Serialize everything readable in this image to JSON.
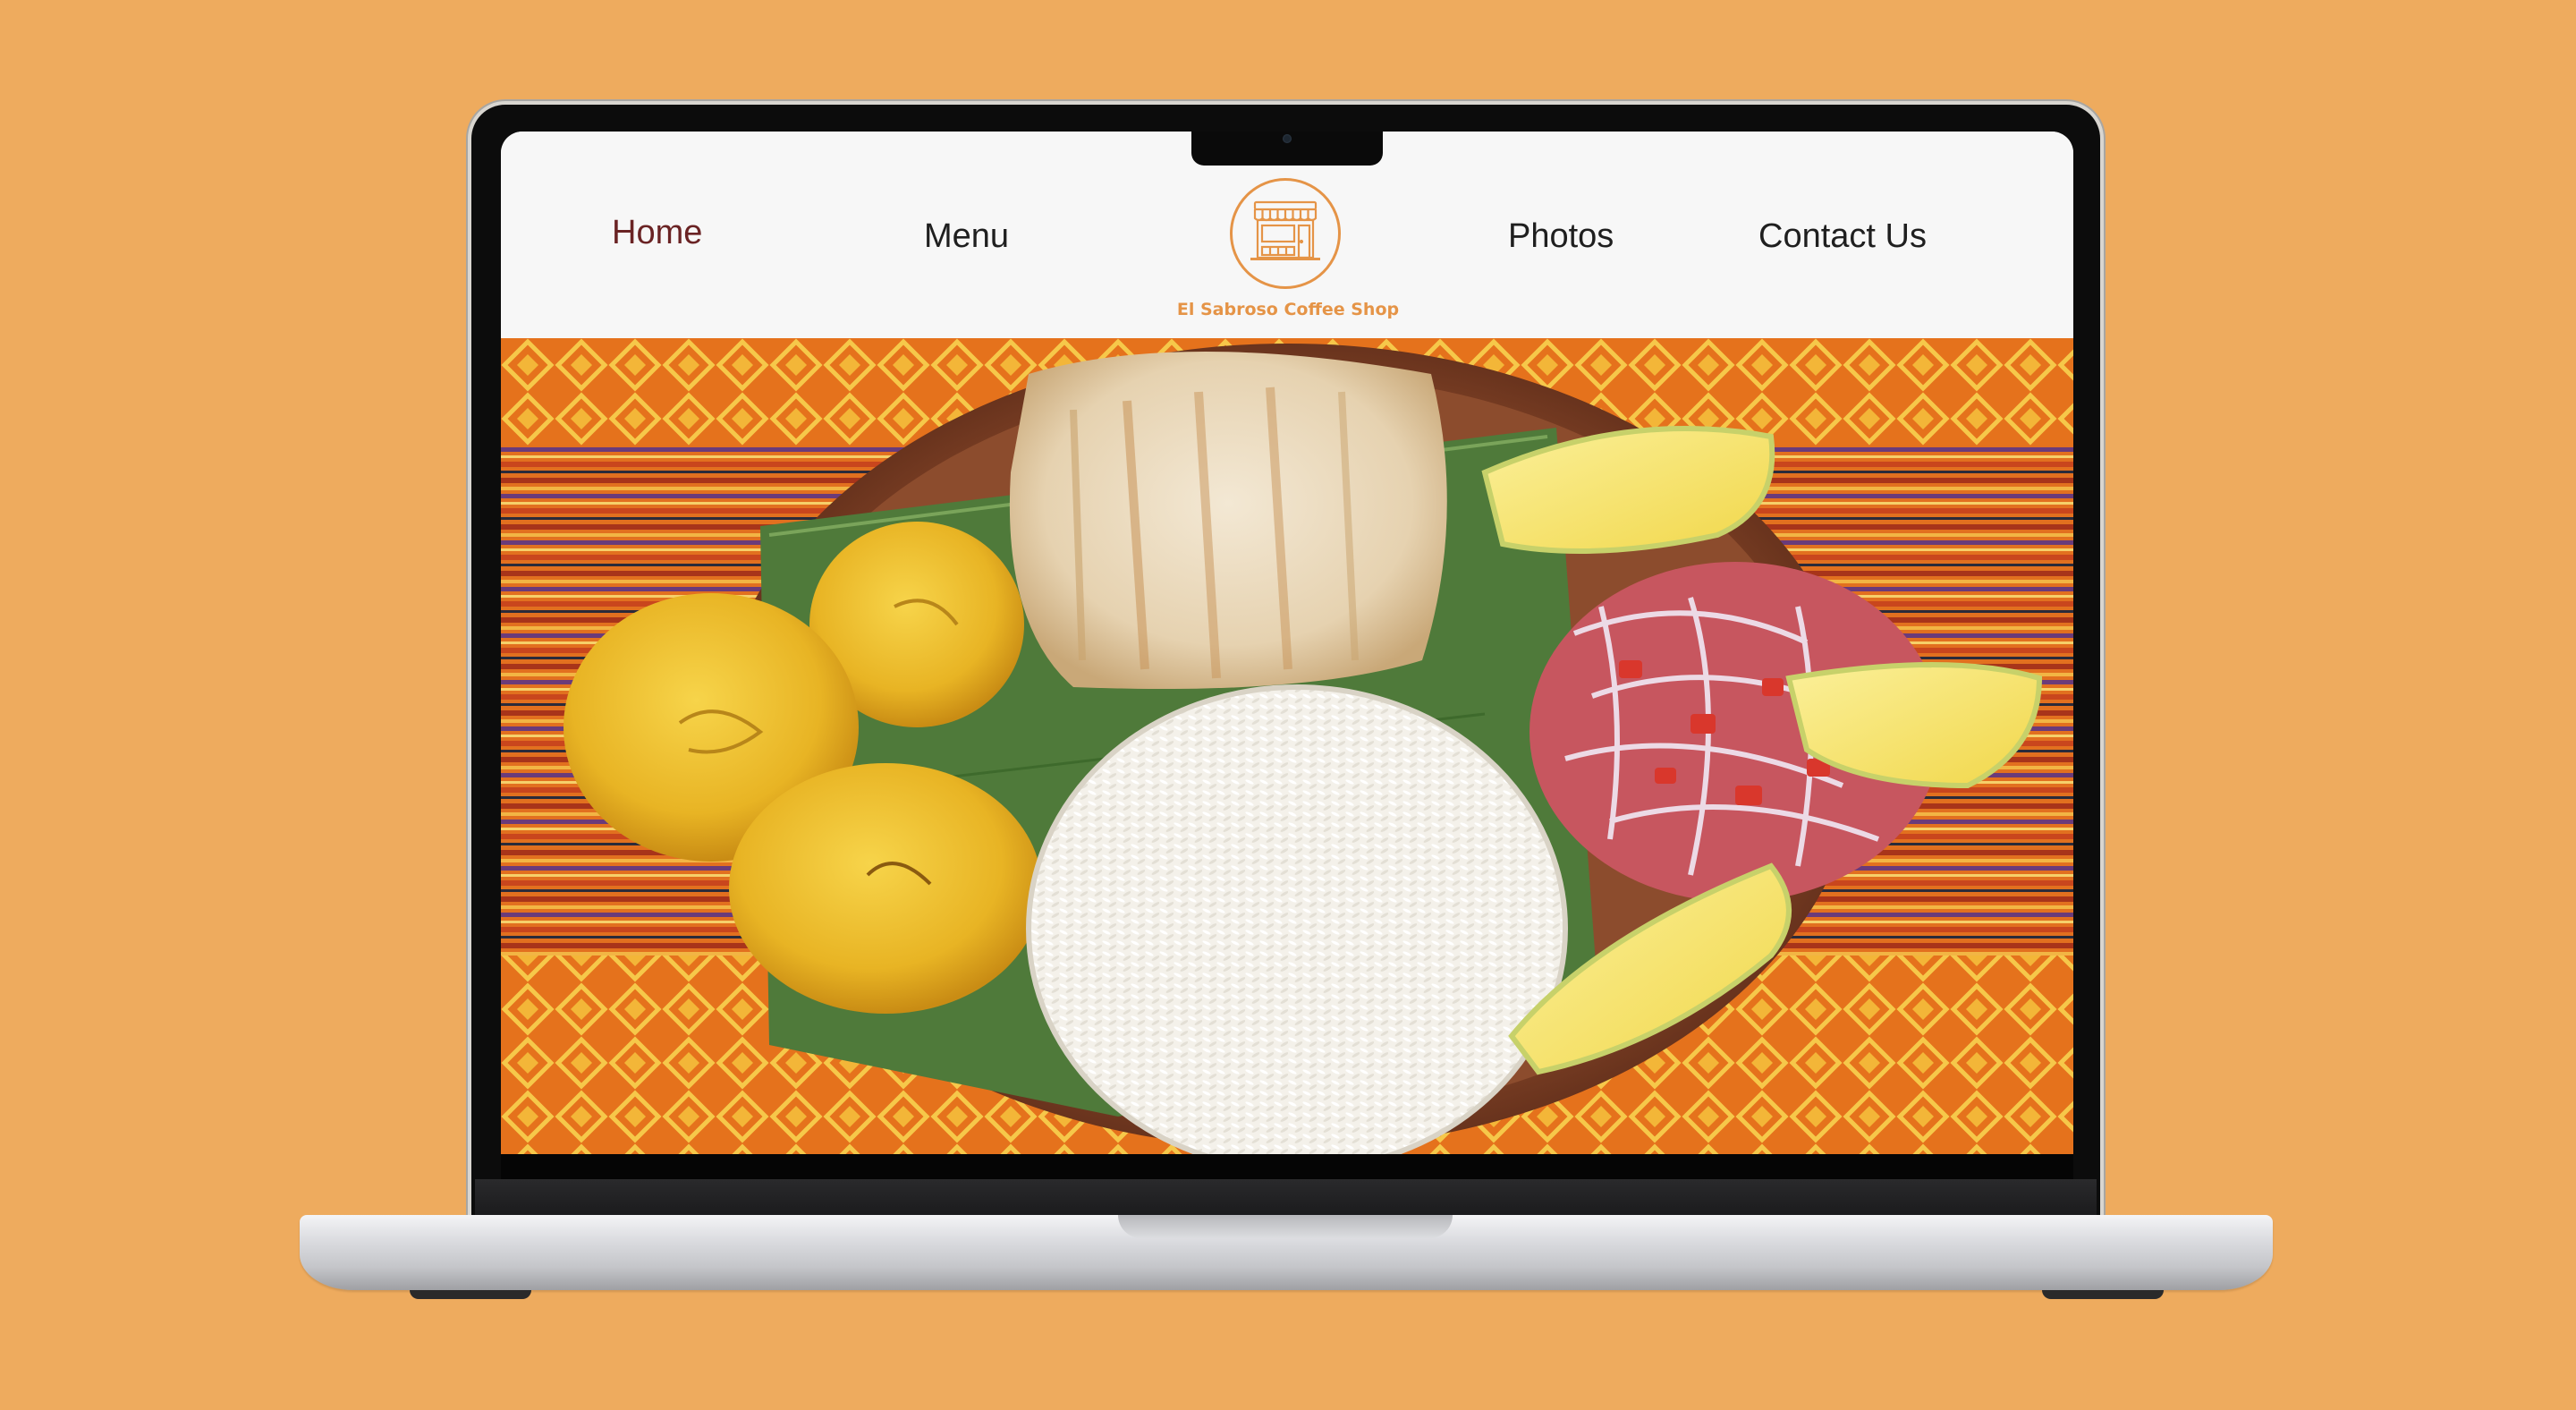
{
  "site": {
    "brand_name": "El Sabroso Coffee Shop",
    "logo_icon": "storefront-icon",
    "brand_color": "#E59447",
    "active_nav_color": "#6a2324"
  },
  "nav": {
    "home": "Home",
    "menu": "Menu",
    "photos": "Photos",
    "contact": "Contact Us",
    "active": "Home"
  },
  "hero": {
    "image_alt": "Plate of grilled fish with white rice, fried plantains, onion-tomato salad and lemon wedges on a woven tablecloth"
  },
  "colors": {
    "background": "#EEAB5E",
    "header_bg": "#f7f7f7"
  }
}
